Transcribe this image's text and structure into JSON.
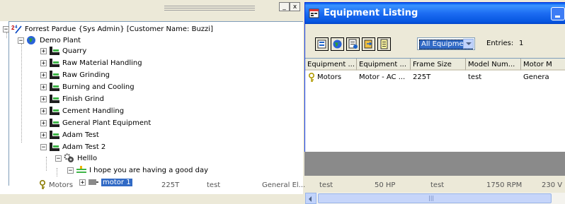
{
  "left_window": {
    "min_glyph": "_",
    "close_glyph": "x"
  },
  "tree": {
    "root": "Forrest Pardue {Sys Admin} [Customer Name: Buzzi]",
    "plant": "Demo Plant",
    "areas": [
      "Quarry",
      "Raw Material Handling",
      "Raw Grinding",
      "Burning and Cooling",
      "Finish Grind",
      "Cement Handling",
      "General Plant Equipment",
      "Adam Test",
      "Adam Test 2"
    ],
    "sub_node": "Helllo",
    "leaf_node": "I hope you are having a good day",
    "partial_node": "motor 1",
    "expand_glyph": "+",
    "collapse_glyph": "−"
  },
  "ghost_row": {
    "name": "Motors",
    "frame": "225T",
    "model": "test",
    "manufacturer": "General El...",
    "c1": "test",
    "c2": "50 HP",
    "c3": "test",
    "c4": "1750 RPM",
    "c5": "230 V"
  },
  "equipment_window": {
    "title": "Equipment Listing",
    "filter_value": "All Equipment",
    "entries_label": "Entries:",
    "entries_count": "1",
    "scroll_grip": "|||",
    "columns": [
      "Equipment ...",
      "Equipment ...",
      "Frame Size",
      "Model Num...",
      "Motor M"
    ],
    "rows": [
      [
        "Motors",
        "Motor - AC ...",
        "225T",
        "test",
        "Genera"
      ]
    ]
  },
  "colors": {
    "titlebar": "#0a5de8",
    "selection": "#316ac5",
    "window_bg": "#ece9d8"
  }
}
